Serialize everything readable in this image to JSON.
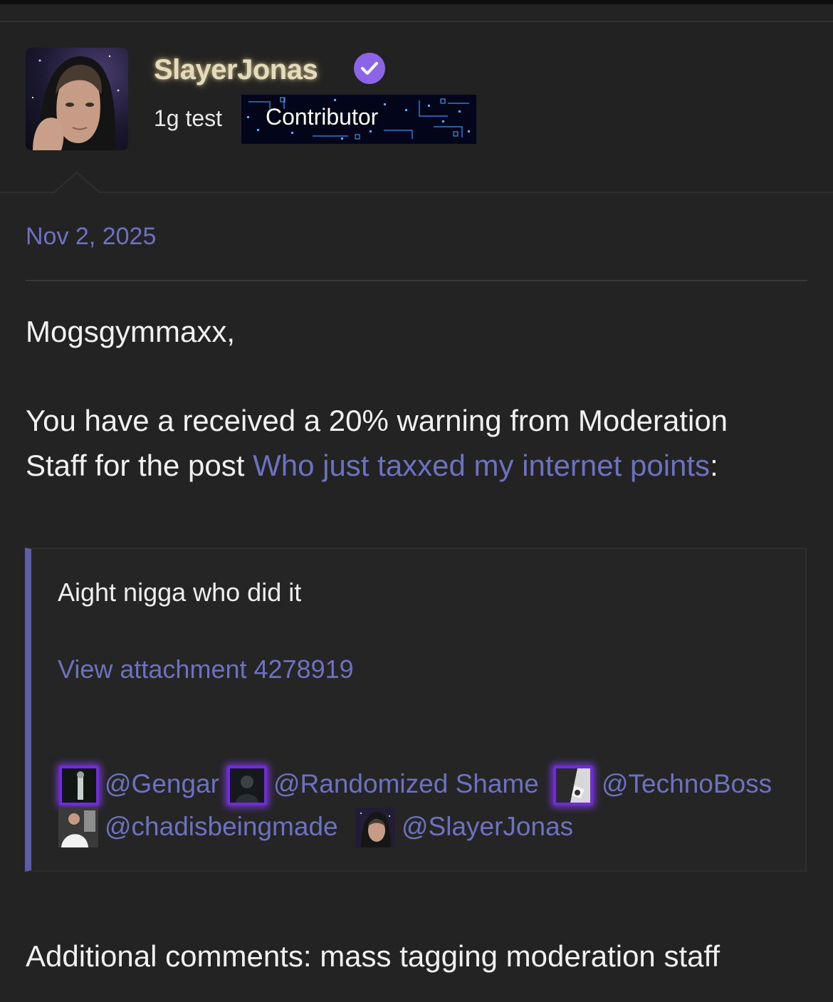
{
  "post": {
    "username": "SlayerJonas",
    "verified_icon": "verified-check-icon",
    "user_title": "1g test",
    "rank_banner": "Contributor",
    "date": "Nov 2, 2025"
  },
  "message": {
    "greeting": "Mogsgymmaxx,",
    "warning_line1": "You have a received a 20% warning from Moderation",
    "warning_line2_prefix": "Staff for the post ",
    "warning_post_link": "Who just taxxed my internet points",
    "warning_line2_suffix": ":",
    "quote": {
      "text": "Aight nigga who did it",
      "attachment_link": "View attachment 4278919",
      "mentions": [
        "@Gengar",
        "@Randomized Shame",
        "@TechnoBoss",
        "@chadisbeingmade",
        "@SlayerJonas"
      ]
    },
    "additional_comments": "Additional comments: mass tagging moderation staff"
  },
  "colors": {
    "background": "#232323",
    "link": "#6c72c0",
    "quote_bar": "#5b5ea6",
    "verified_badge": "#8b64e8"
  }
}
